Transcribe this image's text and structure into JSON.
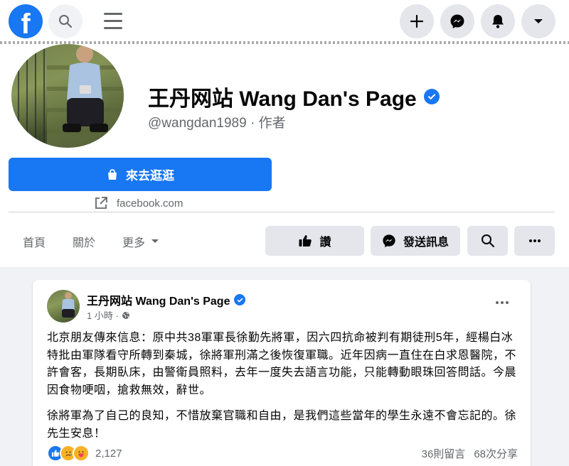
{
  "nav": {
    "logo": "f"
  },
  "profile": {
    "name": "王丹网站 Wang Dan's Page",
    "handle": "@wangdan1989 · 作者",
    "shop_button": "來去逛逛",
    "link": "facebook.com",
    "tabs": [
      "首頁",
      "關於",
      "更多"
    ],
    "like_button": "讚",
    "message_button": "發送訊息"
  },
  "post": {
    "author": "王丹网站 Wang Dan's Page",
    "time": "1 小時 ·",
    "paragraphs": [
      "北京朋友傳來信息：原中共38軍軍長徐勤先將軍，因六四抗命被判有期徒刑5年，經楊白冰特批由軍隊看守所轉到秦城，徐將軍刑滿之後恢復軍職。近年因病一直住在白求恩醫院，不許會客，長期臥床，由警衛員照料，去年一度失去語言功能，只能轉動眼珠回答問話。今晨因食物哽咽，搶救無效，辭世。",
      "徐將軍為了自己的良知，不惜放棄官職和自由，是我們這些當年的學生永遠不會忘記的。徐先生安息！"
    ],
    "reaction_count": "2,127",
    "comments": "36則留言",
    "shares": "68次分享"
  },
  "colors": {
    "brand": "#1877f2",
    "secondary_text": "#65676b",
    "button_gray": "#e4e6eb"
  }
}
